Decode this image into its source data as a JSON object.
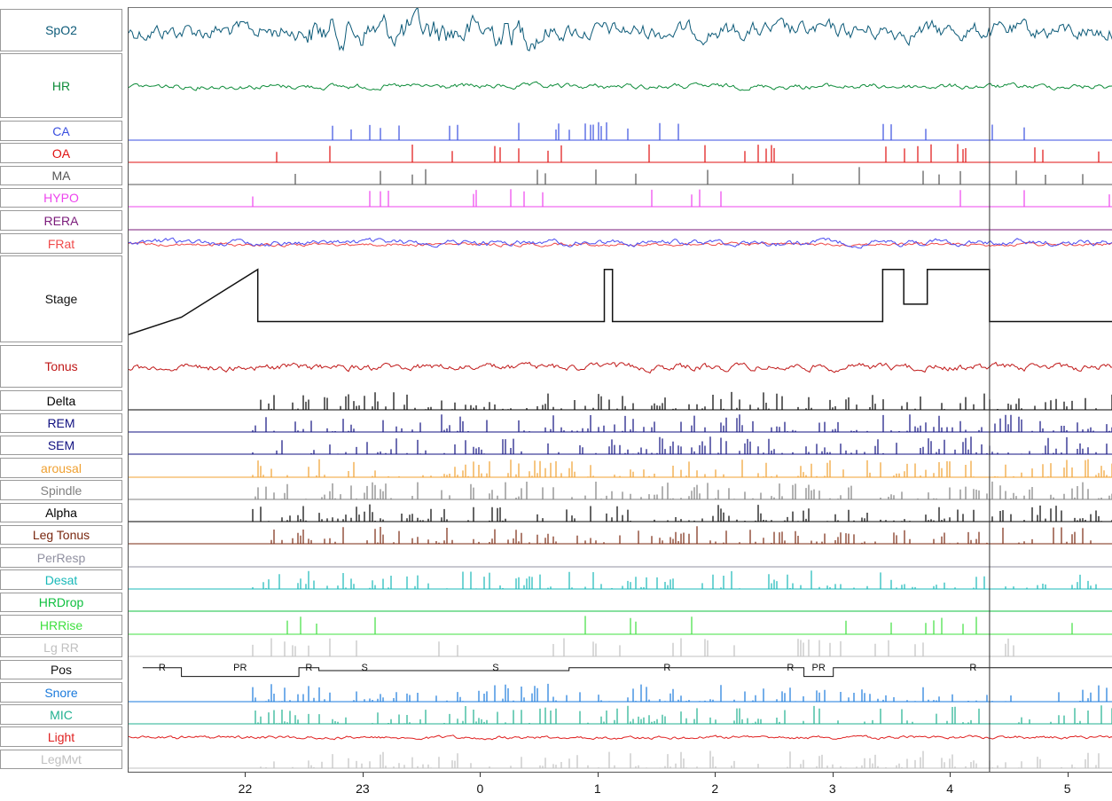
{
  "chart_data": {
    "type": "line",
    "title": "",
    "xlabel": "",
    "ylabel": "",
    "x_ticks": [
      "22",
      "23",
      "0",
      "1",
      "2",
      "3",
      "4",
      "5"
    ],
    "x_range_hours": [
      21.0,
      29.38
    ],
    "cursor_hour": 28.33,
    "grid": false,
    "legend": "none",
    "channels": [
      {
        "name": "SpO2",
        "color": "#0c5a78",
        "kind": "wave"
      },
      {
        "name": "HR",
        "color": "#0e8c3a",
        "kind": "wave"
      },
      {
        "name": "CA",
        "color": "#3a4fe0",
        "kind": "events"
      },
      {
        "name": "OA",
        "color": "#e01010",
        "kind": "events"
      },
      {
        "name": "MA",
        "color": "#555555",
        "kind": "events"
      },
      {
        "name": "HYPO",
        "color": "#ee44ee",
        "kind": "events"
      },
      {
        "name": "RERA",
        "color": "#7a1a7a",
        "kind": "events"
      },
      {
        "name": "FRat",
        "color": "#f04a4a",
        "kind": "wave"
      },
      {
        "name": "Stage",
        "color": "#111111",
        "kind": "stage"
      },
      {
        "name": "Tonus",
        "color": "#c01818",
        "kind": "wave"
      },
      {
        "name": "Delta",
        "color": "#000000",
        "kind": "bars"
      },
      {
        "name": "REM",
        "color": "#101080",
        "kind": "bars"
      },
      {
        "name": "SEM",
        "color": "#101080",
        "kind": "bars"
      },
      {
        "name": "arousal",
        "color": "#f0a030",
        "kind": "bars"
      },
      {
        "name": "Spindle",
        "color": "#808080",
        "kind": "bars"
      },
      {
        "name": "Alpha",
        "color": "#000000",
        "kind": "bars"
      },
      {
        "name": "Leg Tonus",
        "color": "#7a2810",
        "kind": "bars"
      },
      {
        "name": "PerResp",
        "color": "#9090a0",
        "kind": "bars"
      },
      {
        "name": "Desat",
        "color": "#18b8b8",
        "kind": "bars"
      },
      {
        "name": "HRDrop",
        "color": "#10c040",
        "kind": "events"
      },
      {
        "name": "HRRise",
        "color": "#40e040",
        "kind": "events"
      },
      {
        "name": "Lg RR",
        "color": "#c0c0c0",
        "kind": "events"
      },
      {
        "name": "Pos",
        "color": "#111111",
        "kind": "position"
      },
      {
        "name": "Snore",
        "color": "#1a7adc",
        "kind": "bars"
      },
      {
        "name": "MIC",
        "color": "#20b090",
        "kind": "bars"
      },
      {
        "name": "Light",
        "color": "#e02020",
        "kind": "wave"
      },
      {
        "name": "LegMvt",
        "color": "#c0c0c0",
        "kind": "bars"
      }
    ],
    "position_segments": [
      {
        "label": "R",
        "start": 21.12,
        "end": 21.45
      },
      {
        "label": "PR",
        "start": 21.45,
        "end": 22.45
      },
      {
        "label": "R",
        "start": 22.45,
        "end": 22.62
      },
      {
        "label": "S",
        "start": 22.62,
        "end": 23.4
      },
      {
        "label": "S",
        "start": 23.5,
        "end": 24.75
      },
      {
        "label": "R",
        "start": 24.75,
        "end": 26.42
      },
      {
        "label": "R",
        "start": 26.52,
        "end": 26.75
      },
      {
        "label": "PR",
        "start": 26.75,
        "end": 27.0
      },
      {
        "label": "R",
        "start": 27.0,
        "end": 29.38
      }
    ]
  }
}
